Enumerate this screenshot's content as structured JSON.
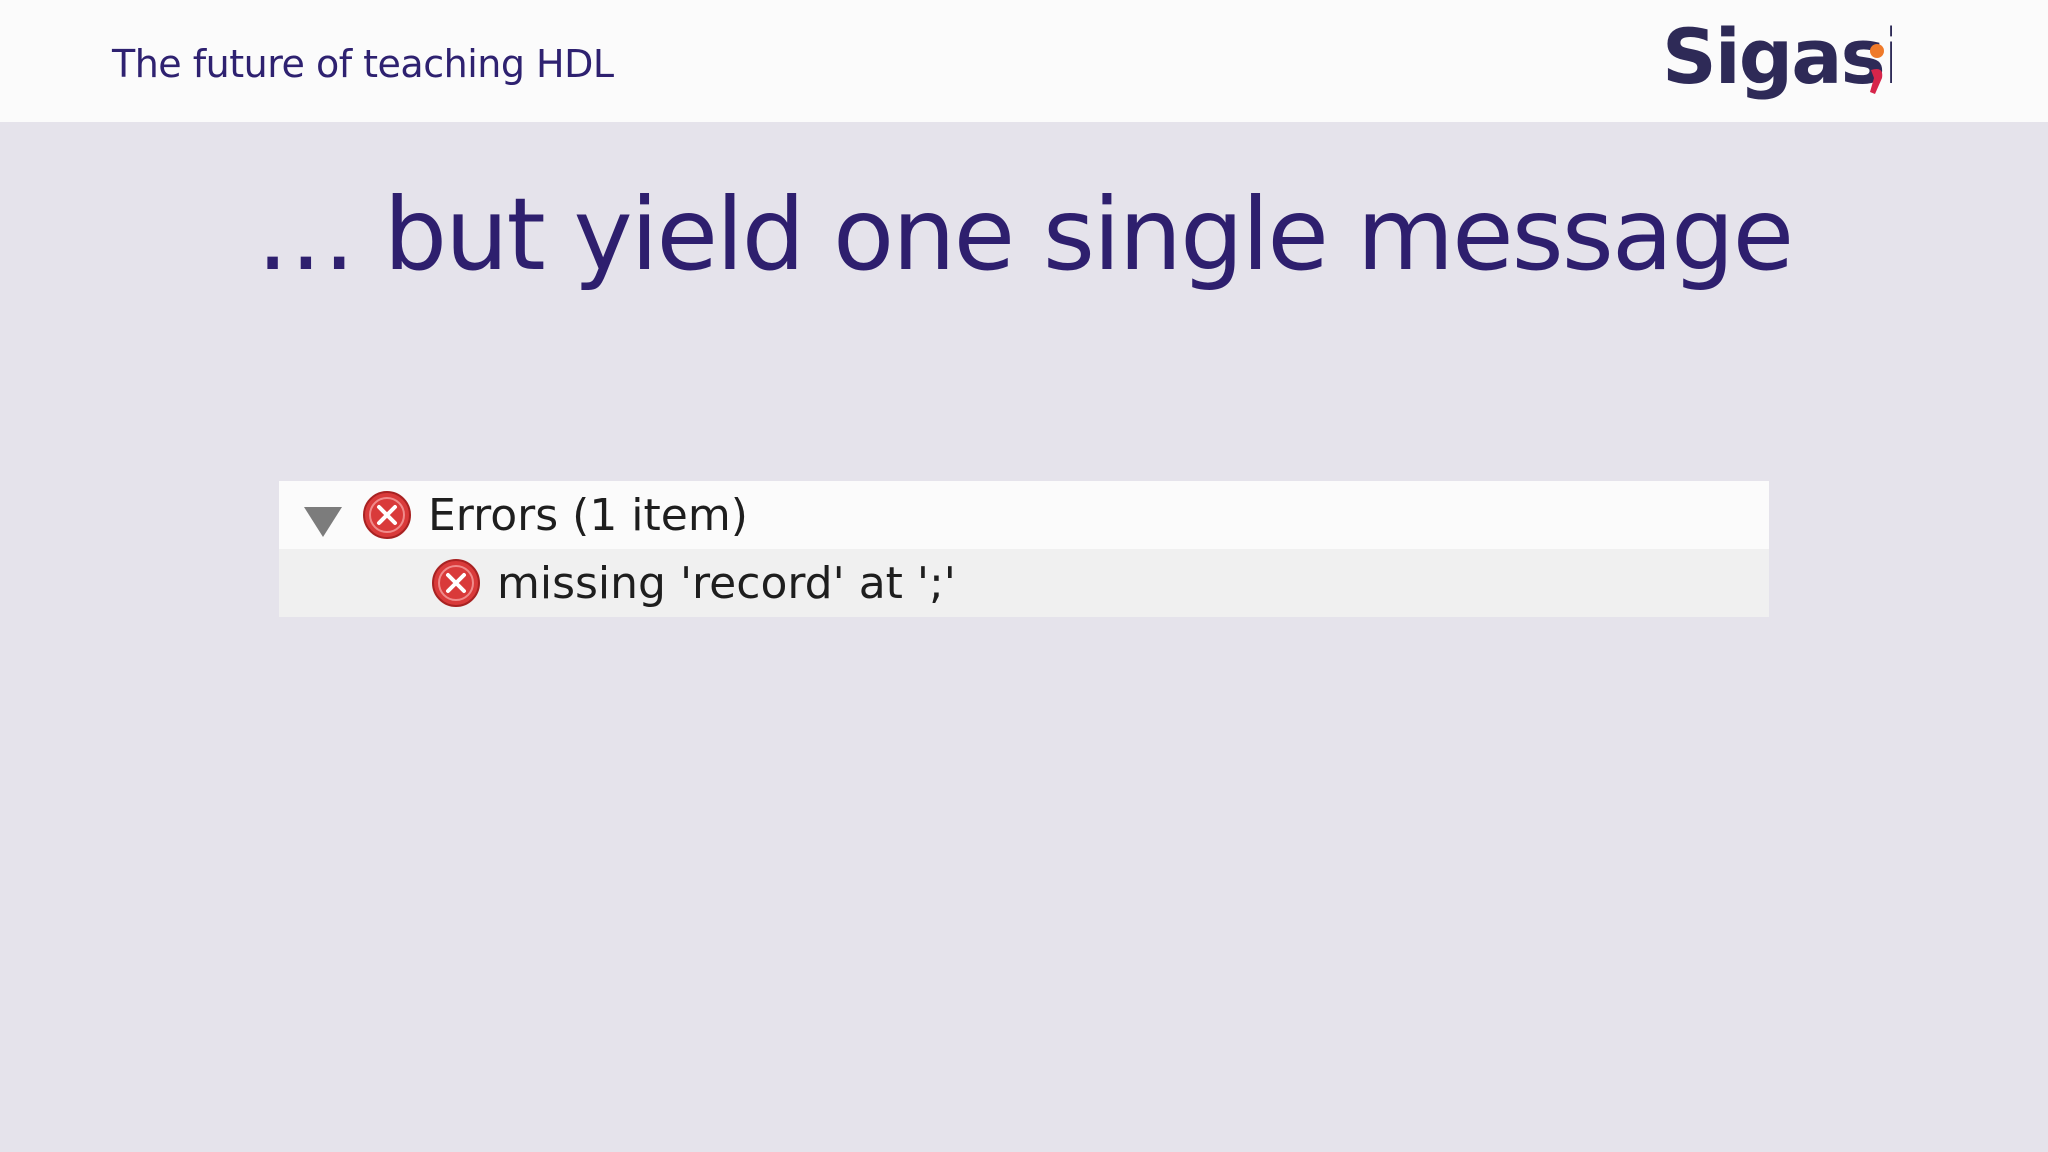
{
  "header": {
    "title": "The future of teaching HDL",
    "logo_text": "Sigasi;"
  },
  "slide": {
    "title": "… but yield one single message"
  },
  "problems_panel": {
    "group": {
      "label": "Errors (1 item)",
      "icon": "error-icon",
      "expanded": true
    },
    "items": [
      {
        "label": "missing 'record' at ';'",
        "icon": "error-icon"
      }
    ]
  },
  "colors": {
    "brand": "#2e1f6e",
    "background": "#e5e3eb",
    "error_red": "#d93a3a",
    "logo_accent": "#e8452b"
  }
}
